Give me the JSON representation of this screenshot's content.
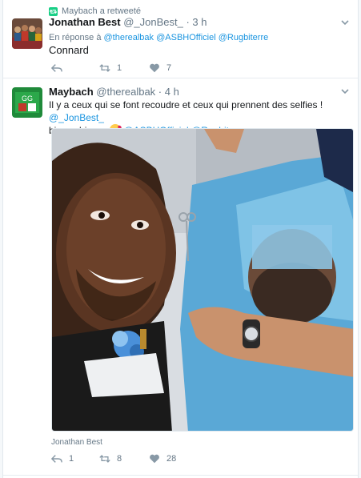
{
  "tweet1": {
    "retweet_context": "Maybach a retweeté",
    "name": "Jonathan Best",
    "handle": "@_JonBest_",
    "time": "· 3 h",
    "reply_prefix": "En réponse à",
    "reply_to": [
      "@therealbak",
      "@ASBHOfficiel",
      "@Rugbiterre"
    ],
    "text": "Connard",
    "retweets": "1",
    "likes": "7",
    "reply_count": ""
  },
  "tweet2": {
    "name": "Maybach",
    "handle": "@therealbak",
    "time": "· 4 h",
    "text_line1": "Il y a ceux qui se font recoudre et ceux qui prennent des selfies !",
    "mention1": "@_JonBest_",
    "text_line2": "bisous bisous",
    "mention2": "@ASBHOfficiel",
    "mention3": "@Rugbiterre",
    "tagged": "Jonathan Best",
    "reply_count": "1",
    "retweets": "8",
    "likes": "28"
  },
  "icons": {
    "reply": "reply-icon",
    "retweet": "retweet-icon",
    "like": "heart-icon",
    "more": "chevron-down-icon"
  },
  "colors": {
    "link": "#1b95e0",
    "retweet_badge": "#19cf86",
    "muted": "#657786"
  }
}
